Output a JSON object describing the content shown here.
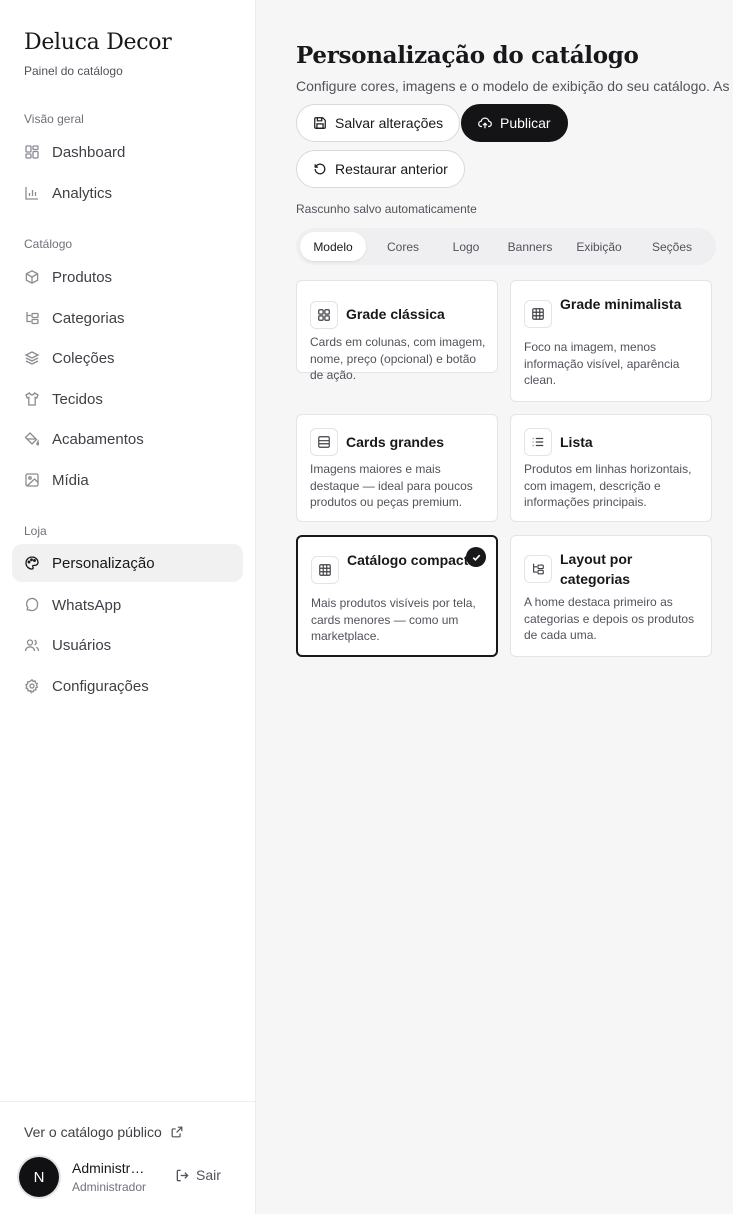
{
  "brand": {
    "name": "Deluca Decor",
    "subtitle": "Painel do catálogo"
  },
  "nav": {
    "sections": [
      {
        "label": "Visão geral",
        "items": [
          {
            "label": "Dashboard",
            "icon": "dashboard-icon"
          },
          {
            "label": "Analytics",
            "icon": "analytics-icon"
          }
        ]
      },
      {
        "label": "Catálogo",
        "items": [
          {
            "label": "Produtos",
            "icon": "box-icon"
          },
          {
            "label": "Categorias",
            "icon": "folder-tree-icon"
          },
          {
            "label": "Coleções",
            "icon": "layers-icon"
          },
          {
            "label": "Tecidos",
            "icon": "shirt-icon"
          },
          {
            "label": "Acabamentos",
            "icon": "paint-bucket-icon"
          },
          {
            "label": "Mídia",
            "icon": "image-icon"
          }
        ]
      },
      {
        "label": "Loja",
        "items": [
          {
            "label": "Personalização",
            "icon": "palette-icon",
            "active": true
          },
          {
            "label": "WhatsApp",
            "icon": "chat-bubble-icon"
          },
          {
            "label": "Usuários",
            "icon": "users-icon"
          },
          {
            "label": "Configurações",
            "icon": "gear-icon"
          }
        ]
      }
    ]
  },
  "footer": {
    "public_link": "Ver o catálogo público",
    "avatar_initial": "N",
    "user_name": "Administrador",
    "user_role": "Administrador",
    "logout": "Sair"
  },
  "page": {
    "title": "Personalização do catálogo",
    "description": "Configure cores, imagens e o modelo de exibição do seu catálogo. As mudanças",
    "save_label": "Salvar alterações",
    "publish_label": "Publicar",
    "restore_label": "Restaurar anterior",
    "autosave": "Rascunho salvo automaticamente"
  },
  "tabs": [
    {
      "label": "Modelo",
      "active": true
    },
    {
      "label": "Cores"
    },
    {
      "label": "Logo"
    },
    {
      "label": "Banners"
    },
    {
      "label": "Exibição"
    },
    {
      "label": "Seções"
    }
  ],
  "layouts": [
    {
      "title": "Grade clássica",
      "description": "Cards em colunas, com imagem, nome, preço (opcional) e botão de ação.",
      "icon": "grid-2x2-icon"
    },
    {
      "title": "Grade minimalista",
      "description": "Foco na imagem, menos informação visível, aparência clean.",
      "icon": "grid-3x3-icon"
    },
    {
      "title": "Cards grandes",
      "description": "Imagens maiores e mais destaque — ideal para poucos produtos ou peças premium.",
      "icon": "large-card-icon"
    },
    {
      "title": "Lista",
      "description": "Produtos em linhas horizontais, com imagem, descrição e informações principais.",
      "icon": "list-icon"
    },
    {
      "title": "Catálogo compacto",
      "description": "Mais produtos visíveis por tela, cards menores — como um marketplace.",
      "icon": "grid-3x3-icon",
      "selected": true
    },
    {
      "title": "Layout por categorias",
      "description": "A home destaca primeiro as categorias e depois os produtos de cada uma.",
      "icon": "folder-tree-icon"
    }
  ]
}
